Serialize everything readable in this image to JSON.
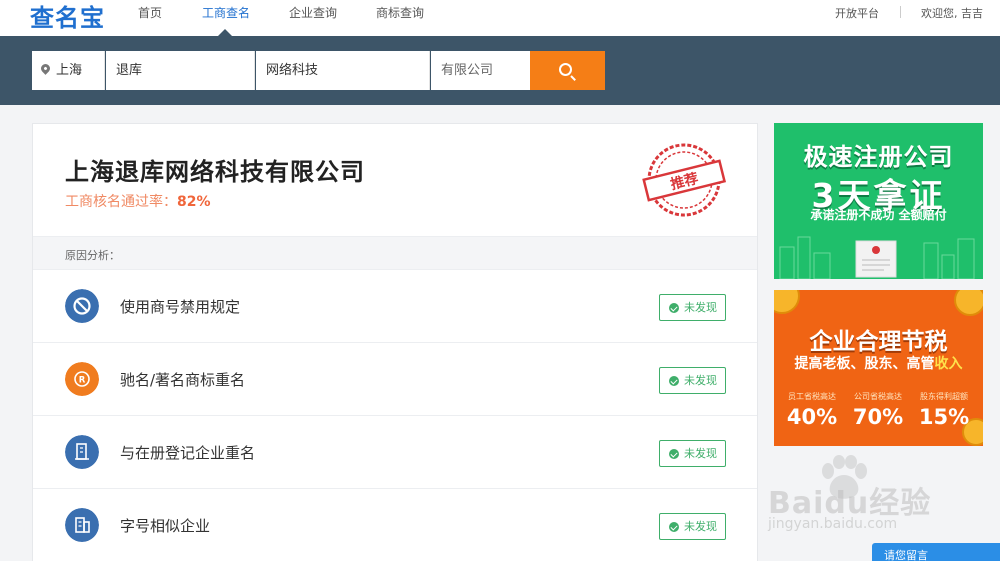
{
  "logo": "查名宝",
  "nav": {
    "items": [
      "首页",
      "工商查名",
      "企业查询",
      "商标查询"
    ],
    "open_platform": "开放平台",
    "welcome": "欢迎您, 吉吉"
  },
  "search": {
    "region": "上海",
    "name": "退库",
    "industry": "网络科技",
    "org_type": "有限公司"
  },
  "result": {
    "company_name": "上海退库网络科技有限公司",
    "pass_rate_label": "工商核名通过率：",
    "pass_rate_value": "82%",
    "stamp_text": "推荐",
    "section_title": "原因分析：",
    "checks": [
      {
        "label": "使用商号禁用规定",
        "status": "未发现",
        "icon": "ban-icon",
        "color": "#3a6fb0"
      },
      {
        "label": "驰名/著名商标重名",
        "status": "未发现",
        "icon": "trademark-icon",
        "color": "#f07c1f"
      },
      {
        "label": "与在册登记企业重名",
        "status": "未发现",
        "icon": "building-icon",
        "color": "#3a6fb0"
      },
      {
        "label": "字号相似企业",
        "status": "未发现",
        "icon": "document-icon",
        "color": "#3a6fb0"
      }
    ]
  },
  "ads": {
    "ad1": {
      "line1": "极速注册公司",
      "line2": "3天拿证",
      "line3": "承诺注册不成功 全额赔付"
    },
    "ad2": {
      "line1": "企业合理节税",
      "line2_a": "提高老板、股东、高管",
      "line2_b": "收入",
      "stats": [
        {
          "label": "员工省税高达",
          "value": "40%"
        },
        {
          "label": "公司省税高达",
          "value": "70%"
        },
        {
          "label": "股东得利超额",
          "value": "15%"
        }
      ]
    }
  },
  "watermark": {
    "brand": "Baidu经验",
    "url": "jingyan.baidu.com"
  },
  "chat_tab": "请您留言",
  "colors": {
    "brand": "#1f6fcf",
    "search_band": "#3d5568",
    "search_button": "#f57e16",
    "ok_green": "#3fae6a",
    "rate": "#f0663b"
  }
}
